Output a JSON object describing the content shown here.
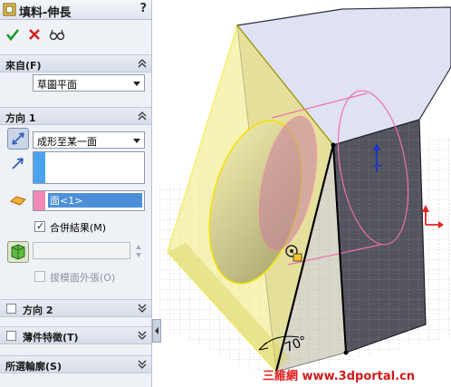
{
  "window": {
    "title": "填料-伸長",
    "help": "?"
  },
  "toolbar": {
    "ok": "confirm-check",
    "cancel": "cancel-x",
    "preview": "detailed-preview"
  },
  "from_section": {
    "title": "來自(F)",
    "dropdown_value": "草圖平面"
  },
  "direction1": {
    "title": "方向 1",
    "end_condition": "成形至某一面",
    "face_selection": "面<1>",
    "merge_result": {
      "label": "合併結果(M)",
      "checked": true
    },
    "draft_outward": {
      "label": "拔模面外張(O)",
      "checked": false
    }
  },
  "direction2": {
    "title": "方向 2",
    "checked": false
  },
  "thin_feature": {
    "title": "薄件特徵(T)",
    "checked": false
  },
  "selected_contours": {
    "title": "所選輪廓(S)"
  },
  "viewport": {
    "angle_label": "70°"
  },
  "watermark": {
    "text_cn": "三維網",
    "text_url": "www.3dportal.cn"
  },
  "colors": {
    "panel_bg": "#eef1f6",
    "selection_blue": "#4c8fd8",
    "pink_strip": "#f08ab4",
    "blue_strip": "#4aa3ef",
    "preview_yellow": "#f2e97a",
    "block_top": "#dfe1f5",
    "block_side": "#555560"
  }
}
